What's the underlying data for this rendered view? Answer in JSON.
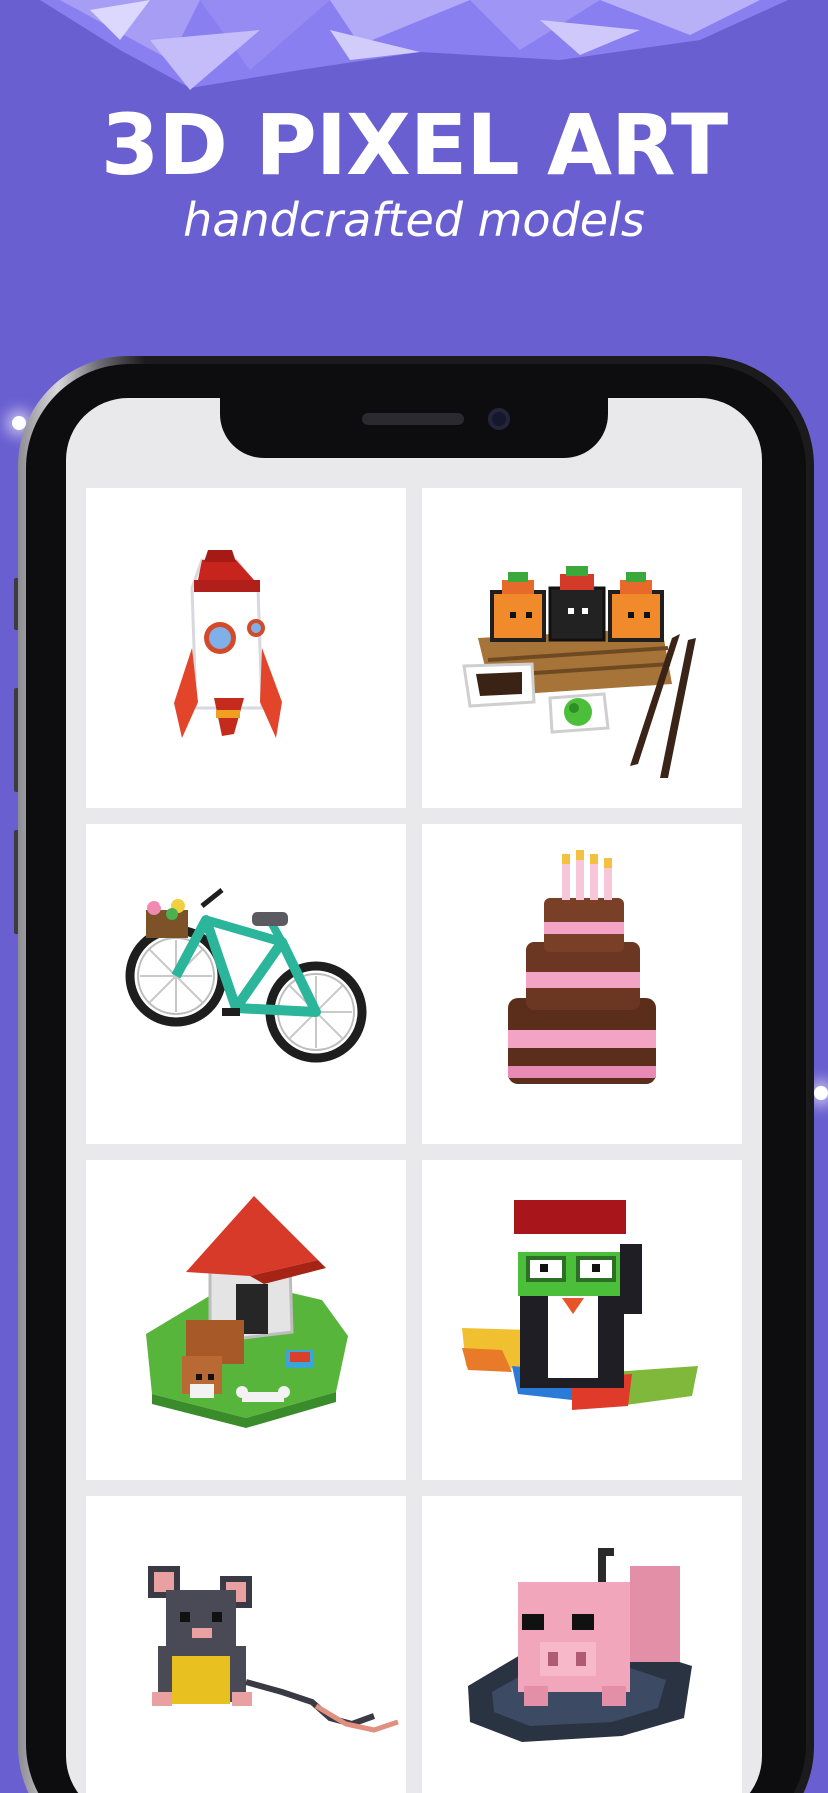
{
  "header": {
    "title": "3D PIXEL ART",
    "subtitle": "handcrafted models"
  },
  "colors": {
    "background": "#6a5fd0",
    "screen": "#e9e9ec",
    "tile": "#ffffff"
  },
  "gallery": {
    "items": [
      {
        "name": "rocket-model",
        "icon": "rocket"
      },
      {
        "name": "sushi-model",
        "icon": "sushi"
      },
      {
        "name": "bicycle-model",
        "icon": "bicycle"
      },
      {
        "name": "cake-model",
        "icon": "cake"
      },
      {
        "name": "doghouse-model",
        "icon": "doghouse"
      },
      {
        "name": "penguin-model",
        "icon": "penguin"
      },
      {
        "name": "mouse-model",
        "icon": "mouse"
      },
      {
        "name": "pig-model",
        "icon": "pig"
      }
    ]
  }
}
